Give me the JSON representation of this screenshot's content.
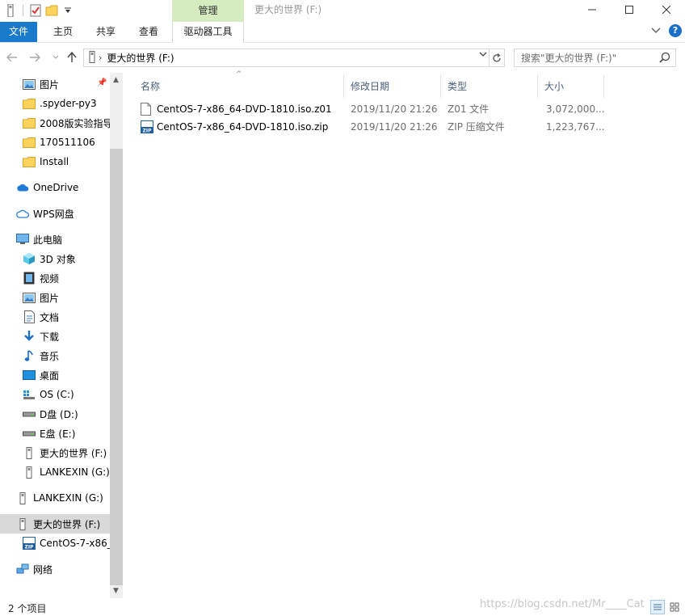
{
  "window": {
    "title": "更大的世界 (F:)",
    "context_tab": "管理"
  },
  "ribbon": {
    "tabs": [
      "文件",
      "主页",
      "共享",
      "查看",
      "驱动器工具"
    ]
  },
  "address": {
    "path": "更大的世界 (F:)",
    "search_placeholder": "搜索\"更大的世界 (F:)\""
  },
  "sidebar": {
    "items": [
      {
        "label": "图片",
        "icon": "pictures-icon",
        "pinned": true
      },
      {
        "label": ".spyder-py3",
        "icon": "folder-icon"
      },
      {
        "label": "2008版实验指导",
        "icon": "folder-icon"
      },
      {
        "label": "170511106",
        "icon": "folder-icon"
      },
      {
        "label": "Install",
        "icon": "folder-icon"
      },
      {
        "label": "OneDrive",
        "icon": "onedrive-icon"
      },
      {
        "label": "WPS网盘",
        "icon": "wps-cloud-icon"
      },
      {
        "label": "此电脑",
        "icon": "this-pc-icon"
      },
      {
        "label": "3D 对象",
        "icon": "3d-objects-icon"
      },
      {
        "label": "视频",
        "icon": "videos-icon"
      },
      {
        "label": "图片",
        "icon": "pictures-icon"
      },
      {
        "label": "文档",
        "icon": "documents-icon"
      },
      {
        "label": "下载",
        "icon": "downloads-icon"
      },
      {
        "label": "音乐",
        "icon": "music-icon"
      },
      {
        "label": "桌面",
        "icon": "desktop-icon"
      },
      {
        "label": "OS (C:)",
        "icon": "windows-drive-icon"
      },
      {
        "label": "D盘 (D:)",
        "icon": "drive-icon"
      },
      {
        "label": "E盘 (E:)",
        "icon": "drive-icon"
      },
      {
        "label": "更大的世界 (F:)",
        "icon": "usb-drive-icon"
      },
      {
        "label": "LANKEXIN (G:)",
        "icon": "usb-drive-icon"
      },
      {
        "label": "LANKEXIN (G:)",
        "icon": "usb-drive-icon"
      },
      {
        "label": "更大的世界 (F:)",
        "icon": "usb-drive-icon",
        "selected": true
      },
      {
        "label": "CentOS-7-x86_",
        "icon": "zip-icon"
      },
      {
        "label": "网络",
        "icon": "network-icon"
      }
    ]
  },
  "columns": [
    "名称",
    "修改日期",
    "类型",
    "大小"
  ],
  "files": [
    {
      "name": "CentOS-7-x86_64-DVD-1810.iso.z01",
      "date": "2019/11/20 21:26",
      "type": "Z01 文件",
      "size": "3,072,000...",
      "icon": "file-icon"
    },
    {
      "name": "CentOS-7-x86_64-DVD-1810.iso.zip",
      "date": "2019/11/20 21:26",
      "type": "ZIP 压缩文件",
      "size": "1,223,767...",
      "icon": "zip-icon"
    }
  ],
  "status": {
    "count": "2 个项目",
    "watermark": "https://blog.csdn.net/Mr____Cat"
  }
}
